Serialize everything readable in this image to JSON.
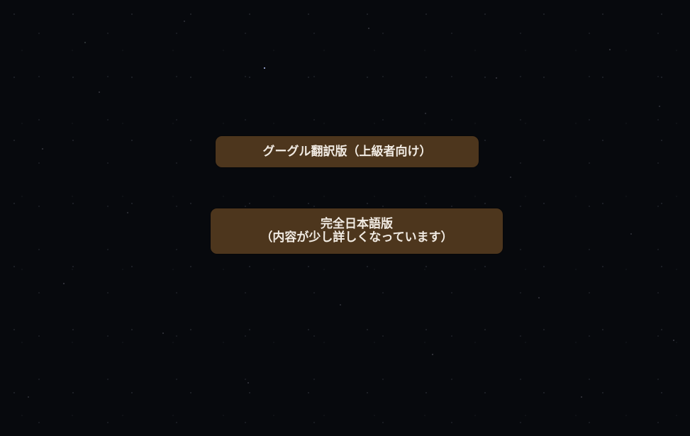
{
  "buttons": {
    "google_translate": {
      "label": "グーグル翻訳版（上級者向け）"
    },
    "japanese": {
      "line1": "完全日本語版",
      "line2": "（内容が少し詳しくなっています）"
    }
  },
  "colors": {
    "background": "#07090d",
    "button_bg": "#4d361d",
    "button_text": "#f1ebe3"
  }
}
